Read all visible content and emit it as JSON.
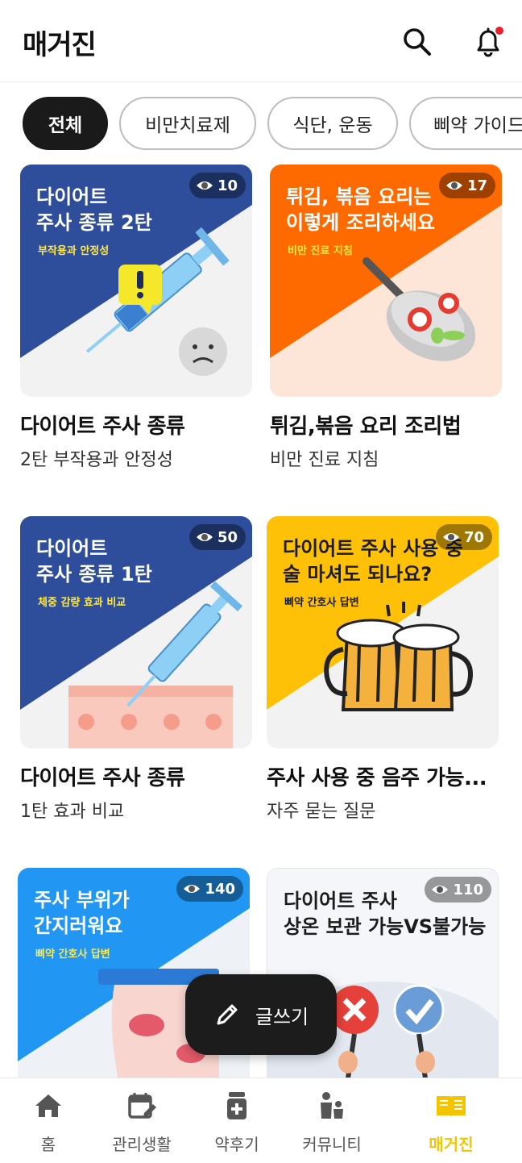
{
  "header": {
    "title": "매거진",
    "search_icon": "search-icon",
    "bell_icon": "bell-icon",
    "notification_dot_color": "#e8202a"
  },
  "chips": [
    "전체",
    "비만치료제",
    "식단, 운동",
    "삐약 가이드"
  ],
  "cards": [
    {
      "thumb_title": "다이어트\n주사 종류 2탄",
      "thumb_sub": "부작용과 안정성",
      "views": "10",
      "title": "다이어트 주사 종류",
      "subtitle": "2탄 부작용과 안정성"
    },
    {
      "thumb_title": "튀김, 볶음 요리는\n이렇게 조리하세요",
      "thumb_sub": "비만 진료 지침",
      "views": "17",
      "title": "튀김,볶음 요리 조리법",
      "subtitle": "비만 진료 지침"
    },
    {
      "thumb_title": "다이어트\n주사 종류 1탄",
      "thumb_sub": "체중 감량 효과 비교",
      "views": "50",
      "title": "다이어트 주사 종류",
      "subtitle": "1탄 효과 비교"
    },
    {
      "thumb_title": "다이어트 주사 사용 중\n술 마셔도 되나요?",
      "thumb_sub": "삐약 간호사 답변",
      "views": "70",
      "title": "주사 사용 중 음주 가능...",
      "subtitle": "자주 묻는 질문"
    },
    {
      "thumb_title": "주사 부위가\n간지러워요",
      "thumb_sub": "삐약 간호사 답변",
      "views": "140",
      "title": "",
      "subtitle": ""
    },
    {
      "thumb_title": "다이어트 주사\n상온 보관 가능VS불가능",
      "thumb_sub": "",
      "views": "110",
      "title": "",
      "subtitle": ""
    }
  ],
  "fab": {
    "label": "글쓰기",
    "icon": "pencil-icon"
  },
  "bottom_nav": [
    {
      "label": "홈",
      "icon": "home-icon",
      "active": false
    },
    {
      "label": "관리생활",
      "icon": "calendar-edit-icon",
      "active": false
    },
    {
      "label": "약후기",
      "icon": "medicine-bottle-icon",
      "active": false
    },
    {
      "label": "커뮤니티",
      "icon": "people-icon",
      "active": false
    },
    {
      "label": "매거진",
      "icon": "book-icon",
      "active": true
    }
  ],
  "colors": {
    "accent": "#f5c400",
    "blue_card": "#2e4e9c",
    "orange_card": "#ff6a00",
    "yellow_card": "#ffc107",
    "sky_card": "#2196f3"
  }
}
